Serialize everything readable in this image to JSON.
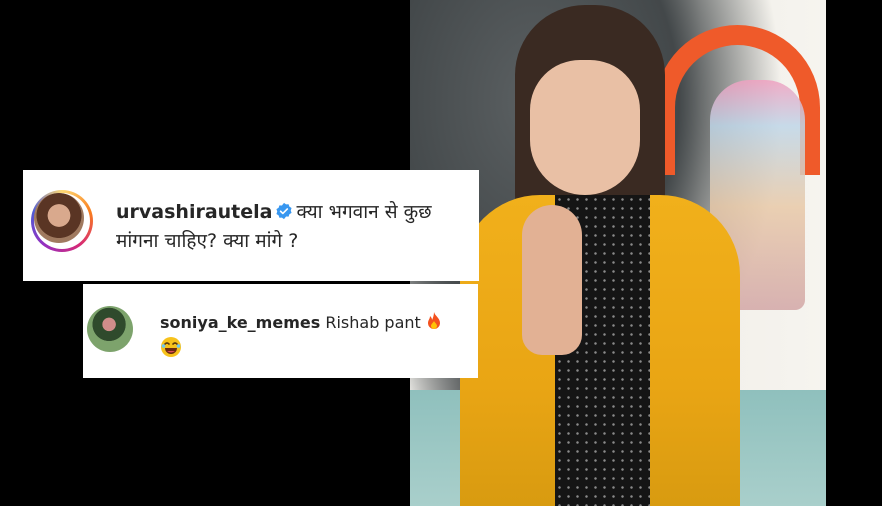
{
  "photo": {
    "subject": ""
  },
  "post_comment": {
    "username": "urvashirautela",
    "text": "क्या भगवान से कुछ मांगना चाहिए? क्या मांगे ?",
    "verified_icon": "verified-badge-icon",
    "avatar_icon": "profile-avatar"
  },
  "reply_comment": {
    "username": "soniya_ke_memes",
    "text": "Rishab pant",
    "emojis": [
      "fire-icon",
      "laughing-face-icon"
    ],
    "meta_cutoff": "...",
    "avatar_icon": "profile-avatar"
  },
  "colors": {
    "verified_blue": "#3897f0",
    "text_dark": "#262626",
    "fire_orange": "#f4511e",
    "emoji_yellow": "#f7c21b"
  }
}
